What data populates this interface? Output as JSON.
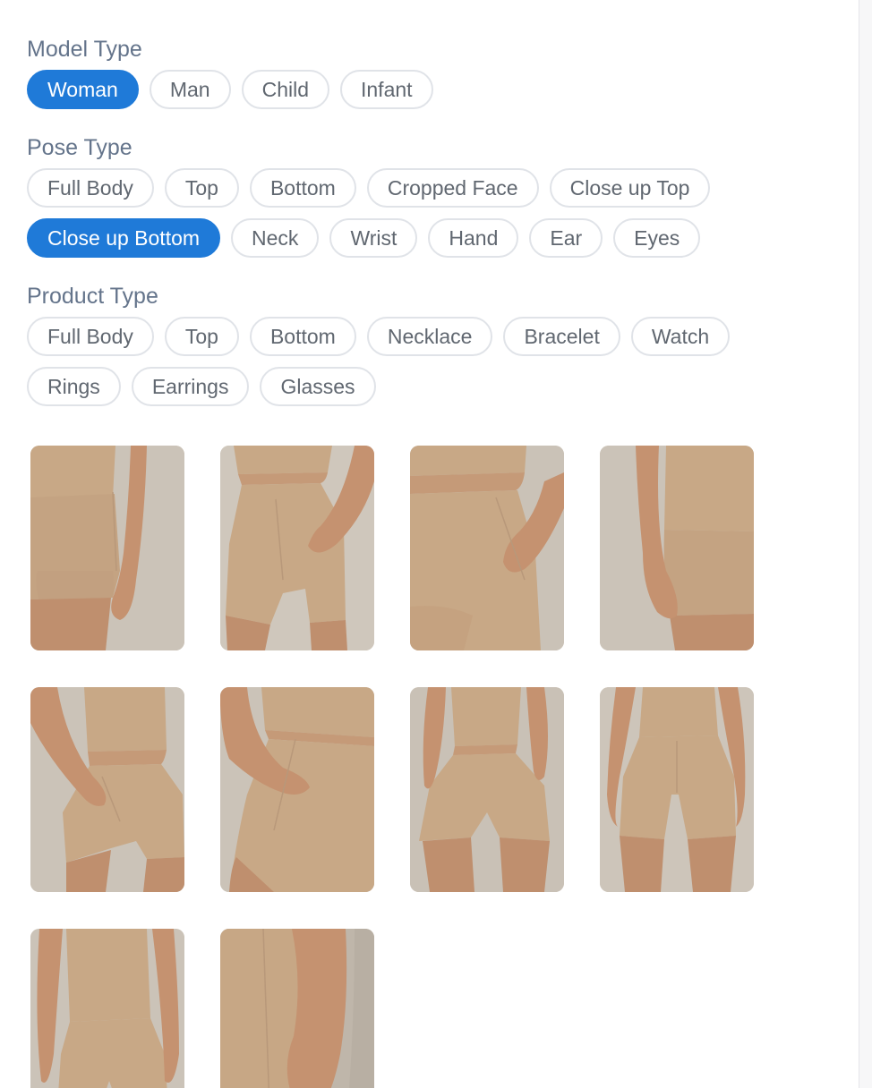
{
  "model_type": {
    "title": "Model Type",
    "options": [
      "Woman",
      "Man",
      "Child",
      "Infant"
    ],
    "selected": "Woman"
  },
  "pose_type": {
    "title": "Pose Type",
    "options_row1": [
      "Full Body",
      "Top",
      "Bottom",
      "Cropped Face",
      "Close up Top"
    ],
    "options_row2": [
      "Close up Bottom",
      "Neck",
      "Wrist",
      "Hand",
      "Ear",
      "Eyes"
    ],
    "selected": "Close up Bottom"
  },
  "product_type": {
    "title": "Product Type",
    "options_row1": [
      "Full Body",
      "Top",
      "Bottom",
      "Necklace",
      "Bracelet",
      "Watch"
    ],
    "options_row2": [
      "Rings",
      "Earrings",
      "Glasses"
    ],
    "selected": null
  },
  "gallery": {
    "image_count": 10,
    "colors": {
      "background": "#cbc3b8",
      "garment": "#c8a886",
      "skin": "#bf8f6e"
    }
  },
  "colors": {
    "accent": "#1f7ad8",
    "section_title": "#64748b",
    "chip_text": "#606770",
    "chip_border": "#e0e3e8"
  }
}
